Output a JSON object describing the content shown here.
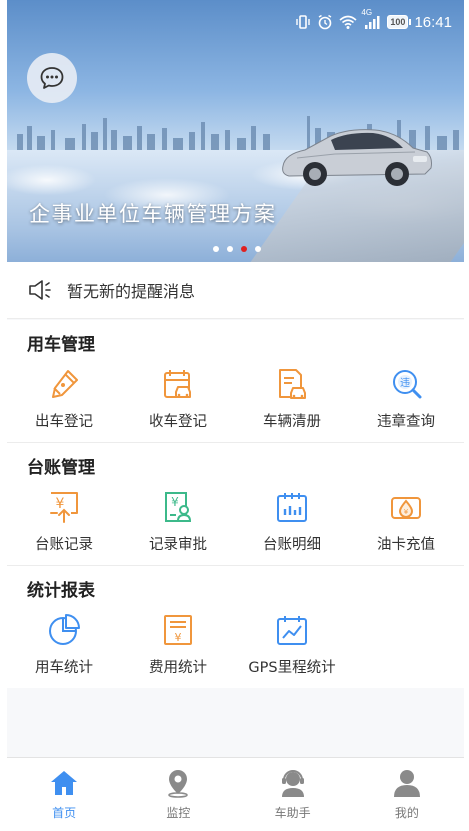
{
  "status_bar": {
    "time": "16:41",
    "network": "4G",
    "battery": "100"
  },
  "banner": {
    "title": "企事业单位车辆管理方案",
    "slide_count": 4,
    "active_slide": 3
  },
  "notice": {
    "text": "暂无新的提醒消息"
  },
  "sections": [
    {
      "title": "用车管理",
      "items": [
        {
          "label": "出车登记",
          "icon": "pen-icon"
        },
        {
          "label": "收车登记",
          "icon": "car-calendar-icon"
        },
        {
          "label": "车辆清册",
          "icon": "car-document-icon"
        },
        {
          "label": "违章查询",
          "icon": "violation-search-icon"
        }
      ]
    },
    {
      "title": "台账管理",
      "items": [
        {
          "label": "台账记录",
          "icon": "yen-upload-icon"
        },
        {
          "label": "记录审批",
          "icon": "approval-icon"
        },
        {
          "label": "台账明细",
          "icon": "bar-calendar-icon"
        },
        {
          "label": "油卡充值",
          "icon": "fuel-card-icon"
        }
      ]
    },
    {
      "title": "统计报表",
      "items": [
        {
          "label": "用车统计",
          "icon": "pie-chart-icon"
        },
        {
          "label": "费用统计",
          "icon": "yen-list-icon"
        },
        {
          "label": "GPS里程统计",
          "icon": "line-chart-icon"
        }
      ]
    }
  ],
  "tabs": [
    {
      "label": "首页",
      "icon": "home-icon",
      "active": true
    },
    {
      "label": "监控",
      "icon": "location-pin-icon",
      "active": false
    },
    {
      "label": "车助手",
      "icon": "assistant-icon",
      "active": false
    },
    {
      "label": "我的",
      "icon": "user-icon",
      "active": false
    }
  ],
  "colors": {
    "orange": "#f0963c",
    "green": "#3cb98a",
    "blue": "#3f8ff0",
    "active_dot": "#e02020"
  }
}
